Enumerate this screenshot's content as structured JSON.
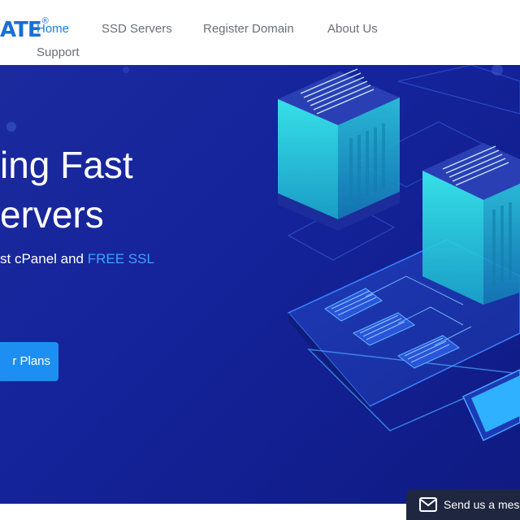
{
  "header": {
    "logo_text": "ATE",
    "logo_mark": "®",
    "nav": [
      {
        "label": "Home",
        "active": true
      },
      {
        "label": "SSD Servers",
        "active": false
      },
      {
        "label": "Register Domain",
        "active": false
      },
      {
        "label": "About Us",
        "active": false
      },
      {
        "label": "Support",
        "active": false
      }
    ]
  },
  "hero": {
    "title_line1": "ing Fast",
    "title_line2": "ervers",
    "subtitle_prefix": "st cPanel and ",
    "subtitle_highlight": "FREE SSL",
    "cta_label": "r Plans"
  },
  "chat": {
    "label": "Send us a mes",
    "icon": "envelope-icon"
  },
  "colors": {
    "brand_blue": "#1a6fd6",
    "nav_active": "#1a7fe0",
    "hero_bg": "#16249a",
    "cta_bg": "#1e8ff2",
    "ssl_highlight": "#3fa2ff",
    "server_cyan": "#2fe0e8",
    "chat_bg": "#1f2740"
  }
}
